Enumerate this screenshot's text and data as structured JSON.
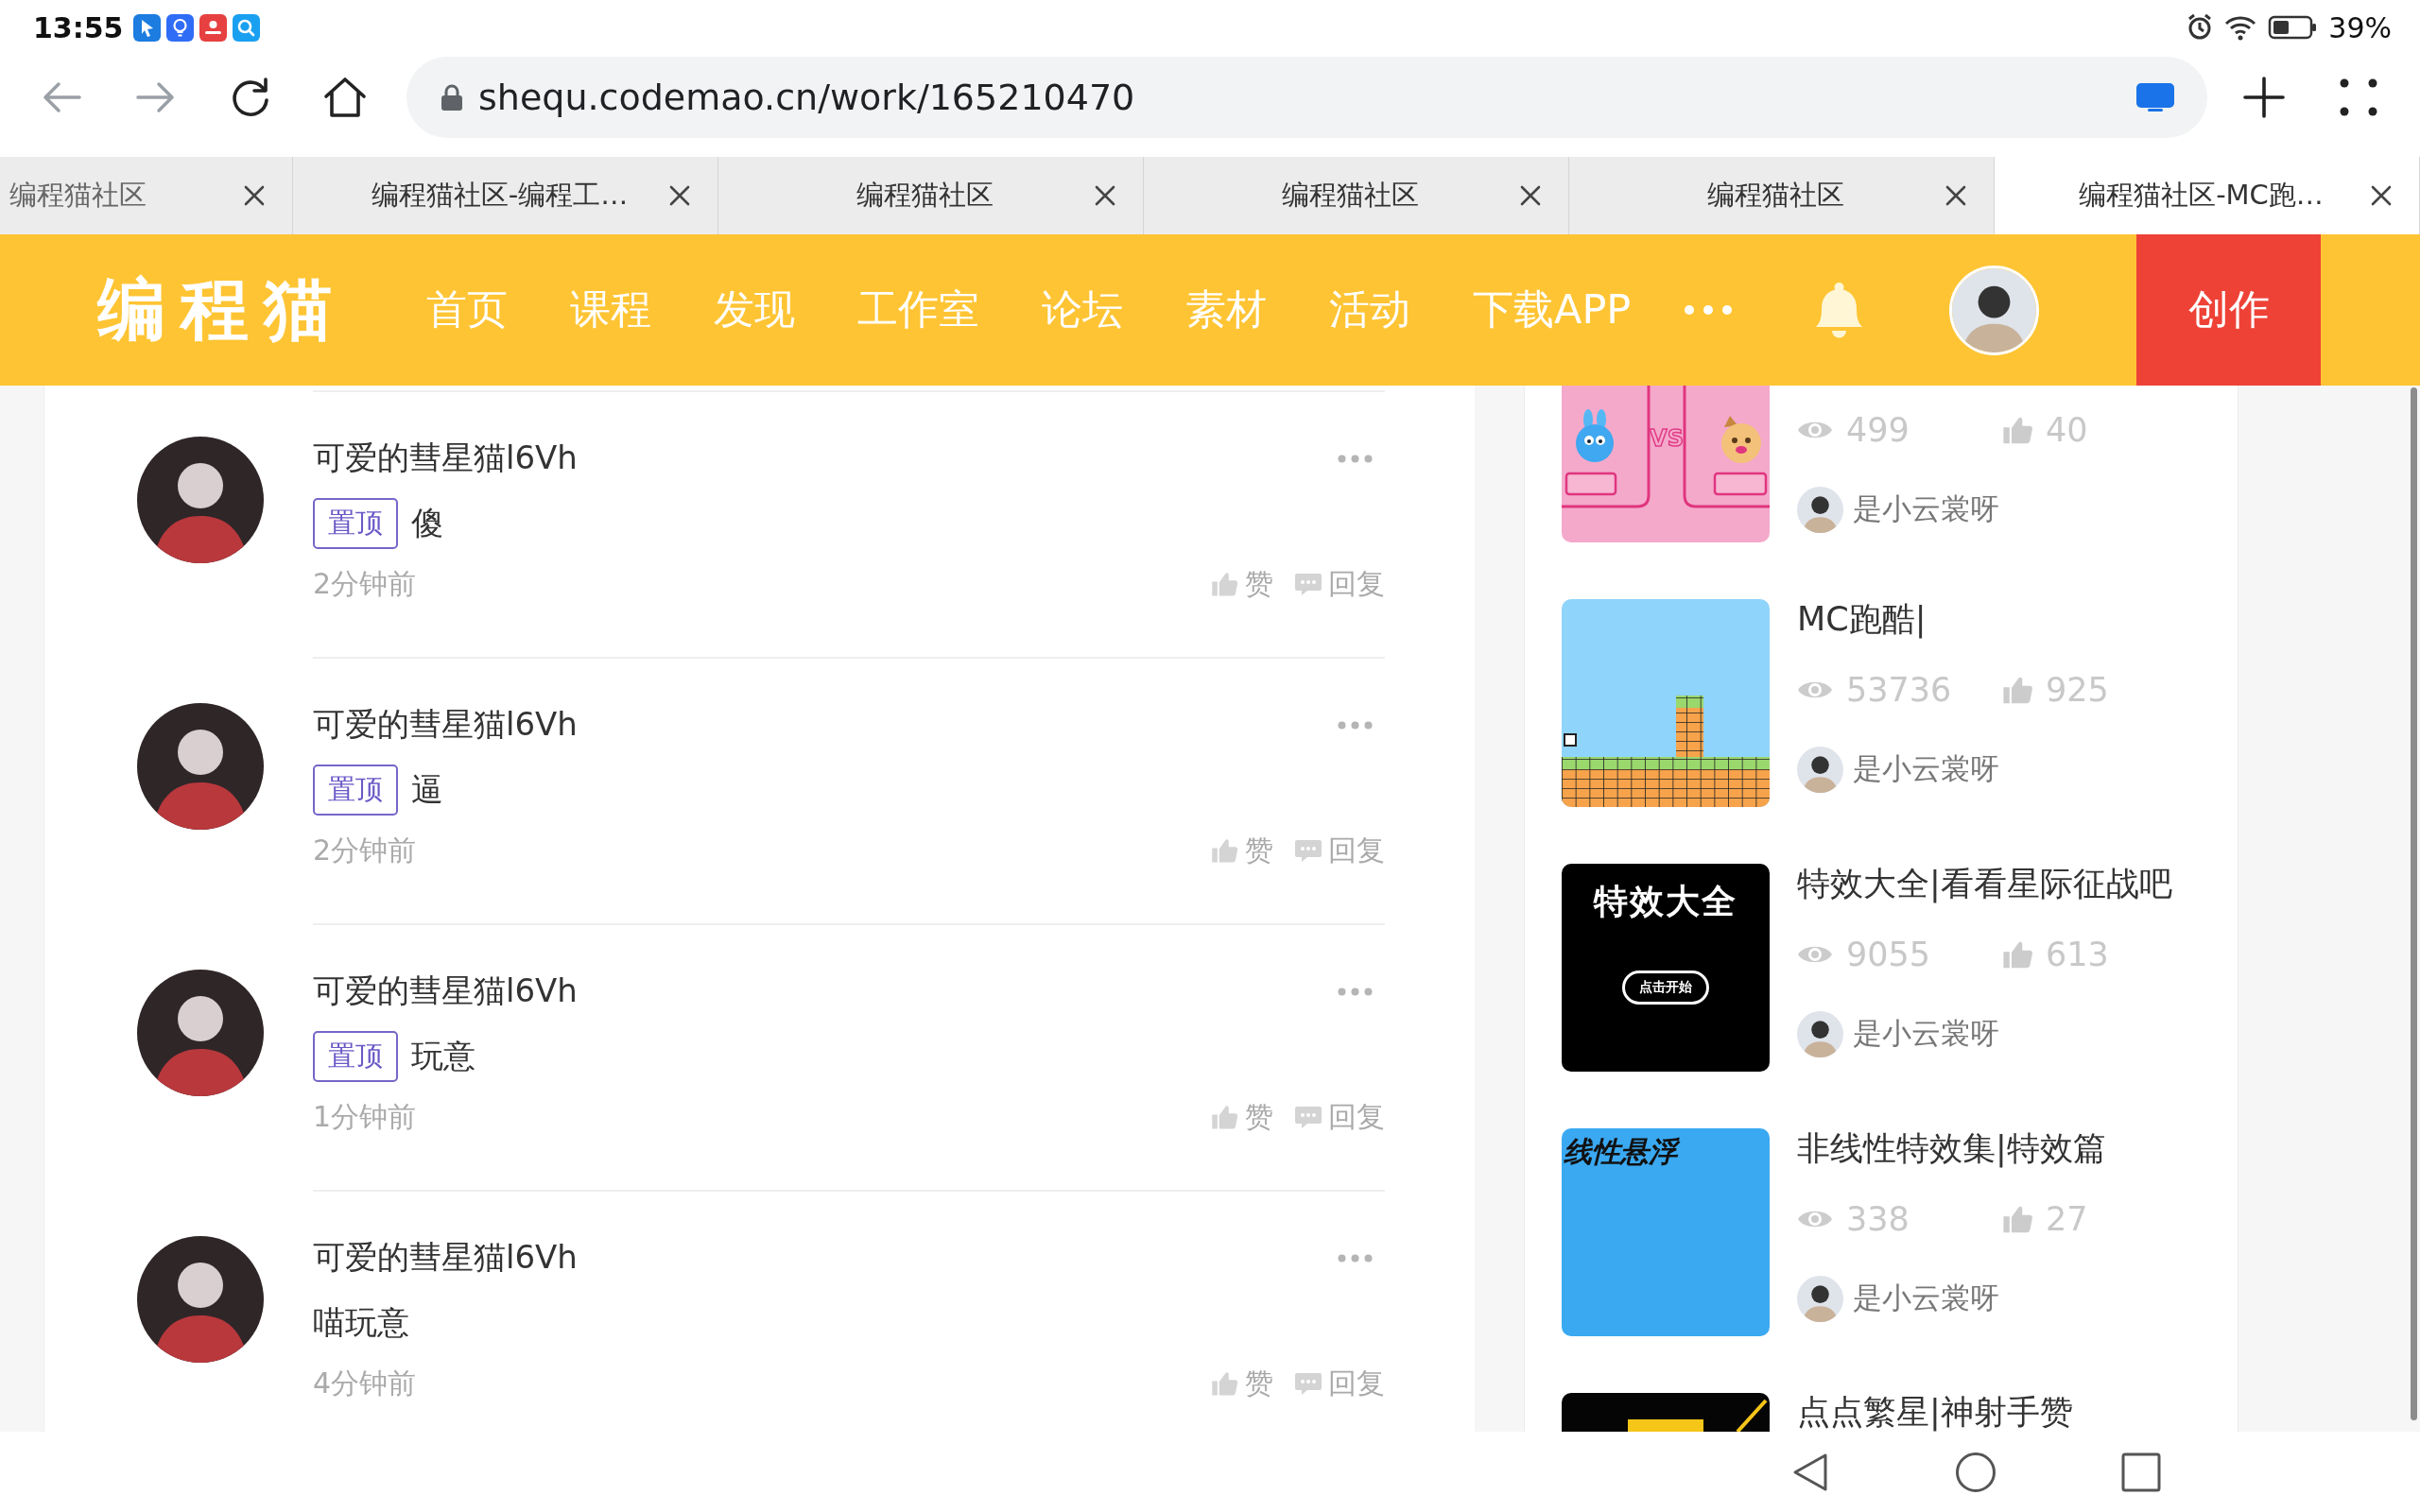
{
  "status_bar": {
    "time": "13:55",
    "battery": "39%"
  },
  "browser": {
    "url": "shequ.codemao.cn/work/165210470"
  },
  "tabs": [
    {
      "title": "编程猫社区",
      "selected": false
    },
    {
      "title": "编程猫社区-编程工…",
      "selected": false
    },
    {
      "title": "编程猫社区",
      "selected": false
    },
    {
      "title": "编程猫社区",
      "selected": false
    },
    {
      "title": "编程猫社区",
      "selected": false
    },
    {
      "title": "编程猫社区-MC跑…",
      "selected": true
    }
  ],
  "nav": {
    "logo": "编程猫",
    "links": [
      "首页",
      "课程",
      "发现",
      "工作室",
      "论坛",
      "素材",
      "活动",
      "下载APP"
    ],
    "create_button": "创作"
  },
  "comments": [
    {
      "user": "可爱的彗星猫l6Vh",
      "tag": "置顶",
      "text": "傻",
      "time": "2分钟前",
      "like": "赞",
      "reply": "回复"
    },
    {
      "user": "可爱的彗星猫l6Vh",
      "tag": "置顶",
      "text": "逼",
      "time": "2分钟前",
      "like": "赞",
      "reply": "回复"
    },
    {
      "user": "可爱的彗星猫l6Vh",
      "tag": "置顶",
      "text": "玩意",
      "time": "1分钟前",
      "like": "赞",
      "reply": "回复"
    },
    {
      "user": "可爱的彗星猫l6Vh",
      "text": "喵玩意",
      "time": "4分钟前",
      "like": "赞",
      "reply": "回复"
    }
  ],
  "works": [
    {
      "cover": {
        "kind": "versus",
        "texts": [
          "VS"
        ]
      },
      "views": "499",
      "likes": "40",
      "author": "是小云裳呀"
    },
    {
      "cover": {
        "kind": "platformer"
      },
      "title": "MC跑酷|",
      "views": "53736",
      "likes": "925",
      "author": "是小云裳呀"
    },
    {
      "cover": {
        "kind": "effects",
        "texts": [
          "特效大全",
          "点击开始"
        ]
      },
      "title": "特效大全|看看星际征战吧",
      "views": "9055",
      "likes": "613",
      "author": "是小云裳呀"
    },
    {
      "cover": {
        "kind": "floating",
        "texts": [
          "线性悬浮"
        ]
      },
      "title": "非线性特效集|特效篇",
      "views": "338",
      "likes": "27",
      "author": "是小云裳呀"
    },
    {
      "cover": {
        "kind": "starry"
      },
      "title": "点点繁星|神射手赞"
    }
  ]
}
